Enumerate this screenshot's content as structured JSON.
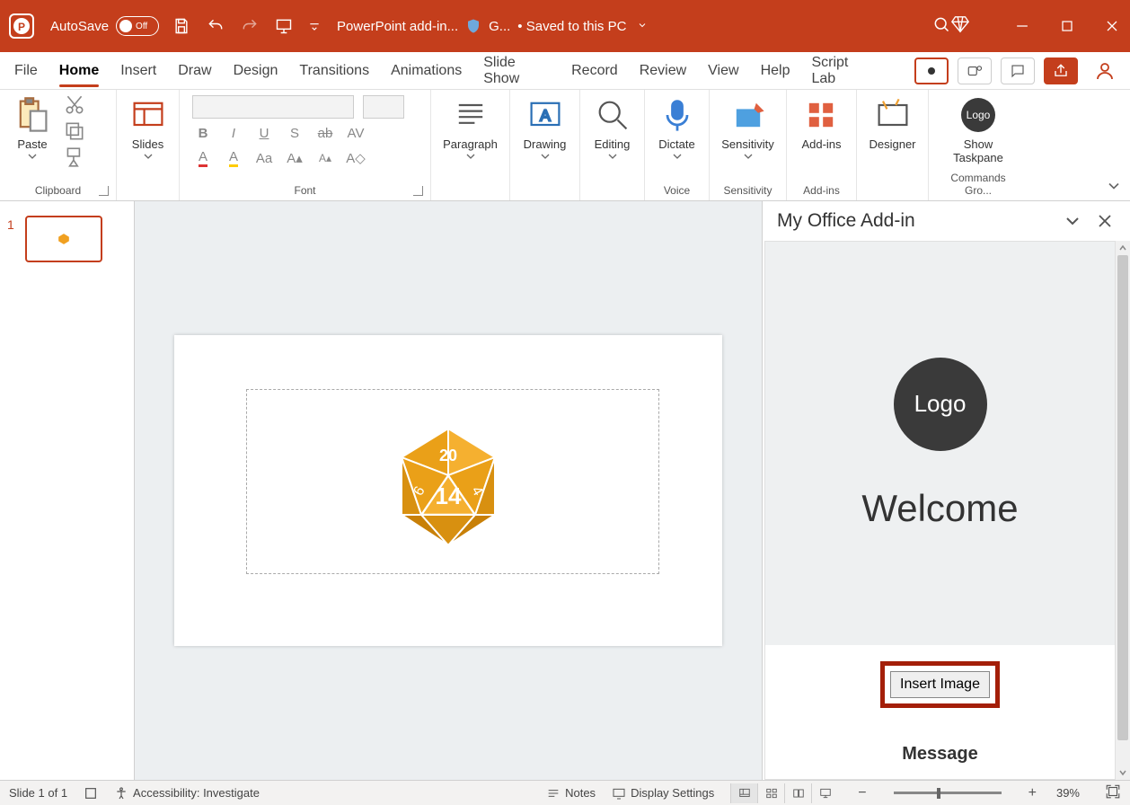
{
  "titlebar": {
    "autosave_label": "AutoSave",
    "autosave_state": "Off",
    "doc_title": "PowerPoint add-in...",
    "shield_text": "G...",
    "saved_status": "• Saved to this PC"
  },
  "tabs": {
    "items": [
      "File",
      "Home",
      "Insert",
      "Draw",
      "Design",
      "Transitions",
      "Animations",
      "Slide Show",
      "Record",
      "Review",
      "View",
      "Help",
      "Script Lab"
    ],
    "active_index": 1
  },
  "ribbon": {
    "clipboard": {
      "paste": "Paste",
      "label": "Clipboard"
    },
    "slides": {
      "slides": "Slides",
      "label": ""
    },
    "font": {
      "label": "Font"
    },
    "paragraph": {
      "label": "Paragraph"
    },
    "drawing": {
      "label": "Drawing"
    },
    "editing": {
      "label": "Editing"
    },
    "dictate": {
      "btn": "Dictate",
      "label": "Voice"
    },
    "sensitivity": {
      "btn": "Sensitivity",
      "label": "Sensitivity"
    },
    "addins": {
      "btn": "Add-ins",
      "label": "Add-ins"
    },
    "designer": {
      "btn": "Designer"
    },
    "taskpane": {
      "btn_line1": "Show",
      "btn_line2": "Taskpane",
      "label": "Commands Gro..."
    },
    "logo_text": "Logo"
  },
  "thumbnails": {
    "slide1_num": "1"
  },
  "taskpane": {
    "title": "My Office Add-in",
    "logo_text": "Logo",
    "welcome": "Welcome",
    "insert_btn": "Insert Image",
    "message": "Message"
  },
  "statusbar": {
    "slide_info": "Slide 1 of 1",
    "accessibility": "Accessibility: Investigate",
    "notes": "Notes",
    "display_settings": "Display Settings",
    "zoom_percent": "39%"
  }
}
